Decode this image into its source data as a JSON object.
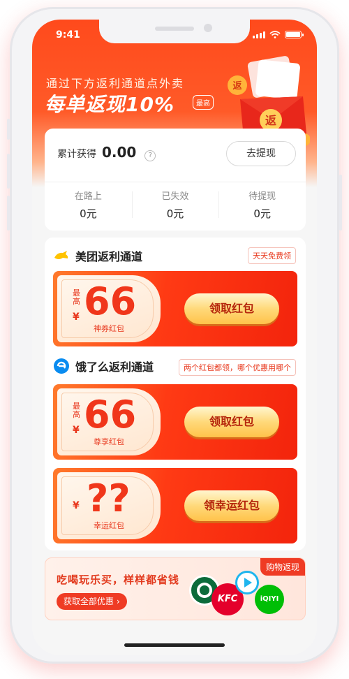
{
  "status_bar": {
    "time": "9:41"
  },
  "hero": {
    "subtitle": "通过下方返利通道点外卖",
    "title": "每单返现10%",
    "badge": "最高",
    "envelope_char": "返"
  },
  "earnings": {
    "label": "累计获得",
    "value": "0.00",
    "help": "?",
    "withdraw_button": "去提现",
    "stats": [
      {
        "label": "在路上",
        "value": "0元"
      },
      {
        "label": "已失效",
        "value": "0元"
      },
      {
        "label": "待提现",
        "value": "0元"
      }
    ]
  },
  "channels": {
    "meituan": {
      "title": "美团返利通道",
      "tag": "天天免费领",
      "coupon": {
        "max": "最高",
        "yen": "¥",
        "amount": "66",
        "sub": "神券红包",
        "button": "领取红包"
      }
    },
    "eleme": {
      "title": "饿了么返利通道",
      "tag": "两个红包都领，哪个优惠用哪个",
      "coupons": [
        {
          "max": "最高",
          "yen": "¥",
          "amount": "66",
          "sub": "尊享红包",
          "button": "领取红包"
        },
        {
          "yen": "¥",
          "amount": "??",
          "sub": "幸运红包",
          "button": "领幸运红包"
        }
      ]
    }
  },
  "promo": {
    "tag": "购物返现",
    "title": "吃喝玩乐买，样样都省钱",
    "button": "获取全部优惠",
    "logos": {
      "kfc": "KFC",
      "iqiyi": "iQIYI"
    }
  },
  "colors": {
    "accent": "#ef3b24",
    "gold": "#ffd97a"
  }
}
